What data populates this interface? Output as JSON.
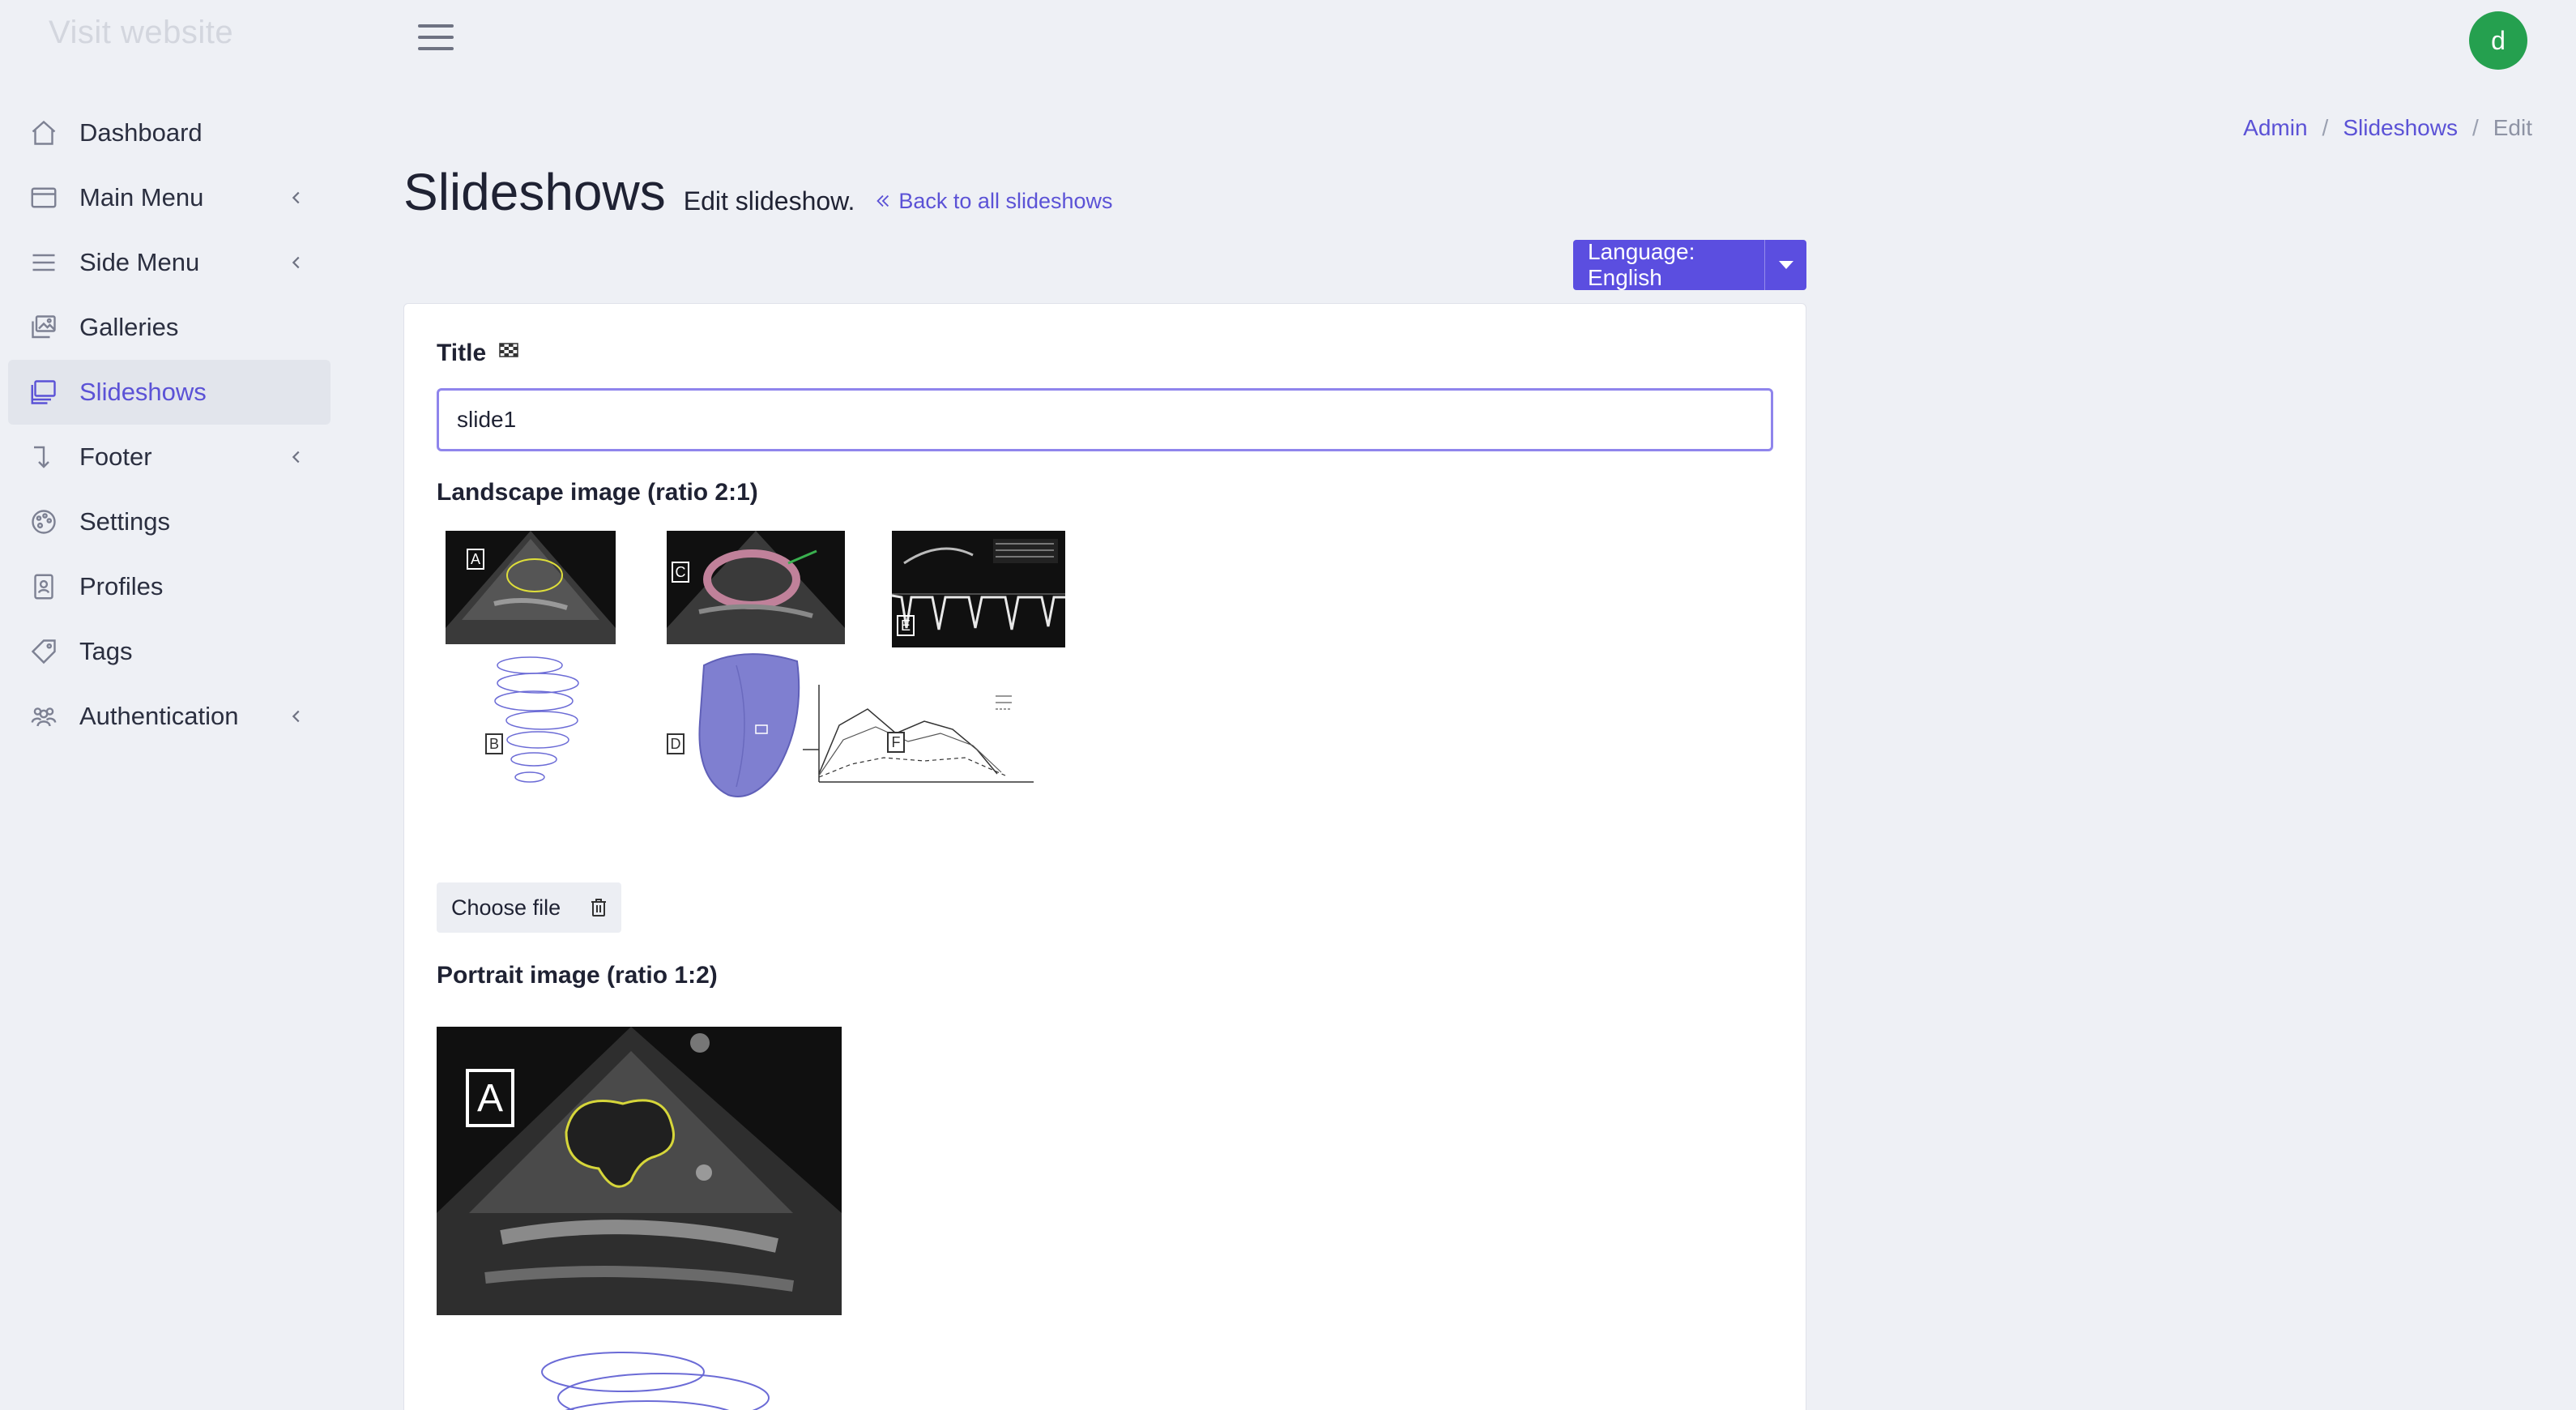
{
  "brand": {
    "label": "Visit website"
  },
  "user": {
    "initial": "d",
    "avatar_color": "#25a04f"
  },
  "sidebar": {
    "items": [
      {
        "label": "Dashboard",
        "icon": "home-icon",
        "has_submenu": false,
        "active": false
      },
      {
        "label": "Main Menu",
        "icon": "window-icon",
        "has_submenu": true,
        "active": false
      },
      {
        "label": "Side Menu",
        "icon": "menu-lines-icon",
        "has_submenu": true,
        "active": false
      },
      {
        "label": "Galleries",
        "icon": "images-icon",
        "has_submenu": false,
        "active": false
      },
      {
        "label": "Slideshows",
        "icon": "slides-icon",
        "has_submenu": false,
        "active": true
      },
      {
        "label": "Footer",
        "icon": "footer-arrow-icon",
        "has_submenu": true,
        "active": false
      },
      {
        "label": "Settings",
        "icon": "palette-icon",
        "has_submenu": false,
        "active": false
      },
      {
        "label": "Profiles",
        "icon": "profile-badge-icon",
        "has_submenu": false,
        "active": false
      },
      {
        "label": "Tags",
        "icon": "tag-icon",
        "has_submenu": false,
        "active": false
      },
      {
        "label": "Authentication",
        "icon": "users-icon",
        "has_submenu": true,
        "active": false
      }
    ]
  },
  "breadcrumb": {
    "items": [
      "Admin",
      "Slideshows"
    ],
    "current": "Edit"
  },
  "page": {
    "title": "Slideshows",
    "subtitle": "Edit slideshow.",
    "back_link": "Back to all slideshows"
  },
  "language": {
    "label": "Language: English"
  },
  "form": {
    "title_label": "Title",
    "title_value": "slide1",
    "landscape_label": "Landscape image (ratio 2:1)",
    "choose_file_label": "Choose file",
    "portrait_label": "Portrait image (ratio 1:2)"
  },
  "figure_labels": [
    "A",
    "B",
    "C",
    "D",
    "E",
    "F"
  ],
  "colors": {
    "accent": "#5b4ee0",
    "link": "#5b52d6",
    "background": "#eef0f5"
  }
}
